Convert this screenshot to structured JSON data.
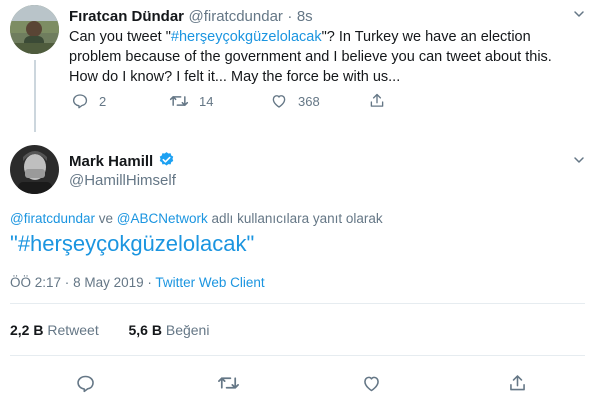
{
  "parent_tweet": {
    "name": "Fıratcan Dündar",
    "handle": "@firatcdundar",
    "separator": "·",
    "time": "8s",
    "text_before": "Can you tweet \"",
    "hashtag": "#herşeyçokgüzelolacak",
    "text_after_line1": "\"? In Turkey we have an election",
    "text_line2": "problem because of the government and I believe you can tweet about this.",
    "text_line3": "How do I know? I felt it... May the force be with us...",
    "reply_count": "2",
    "retweet_count": "14",
    "like_count": "368"
  },
  "main_tweet": {
    "name": "Mark Hamill",
    "handle": "@HamillHimself",
    "reply_to_user1": "@firatcdundar",
    "reply_to_conj": "ve",
    "reply_to_user2": "@ABCNetwork",
    "reply_to_suffix": "adlı kullanıcılara yanıt olarak",
    "quote_open": "\"",
    "hashtag": "#herşeyçokgüzelolacak",
    "quote_close": "\"",
    "time": "ÖÖ 2:17",
    "date_sep": "·",
    "date": "8 May 2019",
    "client_sep": "·",
    "client": "Twitter Web Client",
    "retweets_num": "2,2 B",
    "retweets_label": "Retweet",
    "likes_num": "5,6 B",
    "likes_label": "Beğeni"
  },
  "colors": {
    "link": "#1b95e0",
    "muted": "#657786",
    "verified": "#1da1f2",
    "divider": "#e6ecf0"
  }
}
